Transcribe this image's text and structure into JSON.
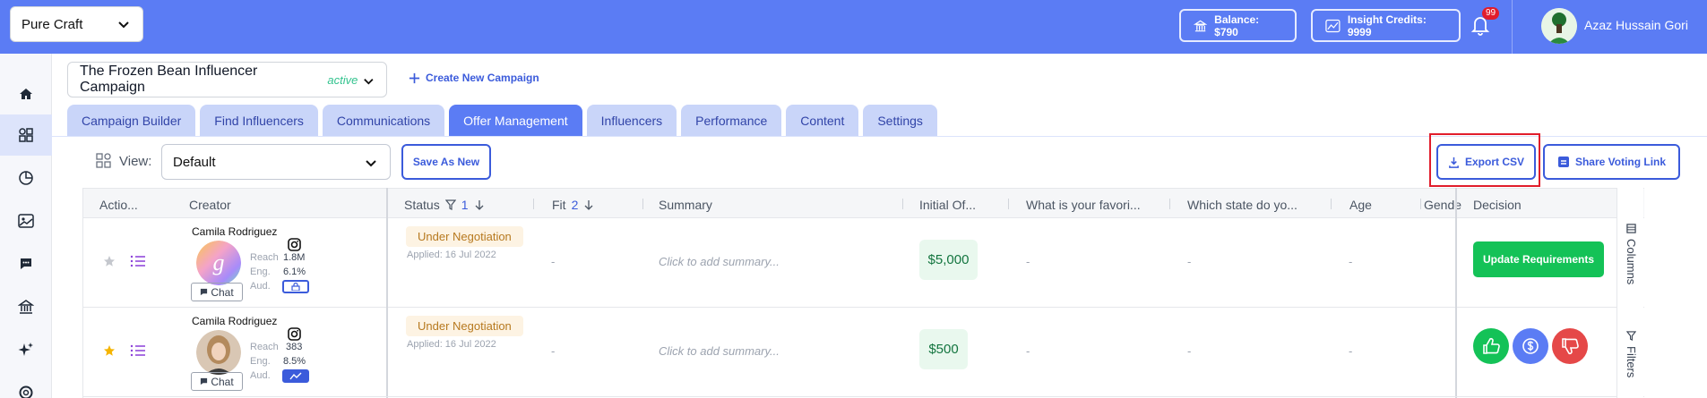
{
  "topbar": {
    "brand": "Pure Craft",
    "balance": "Balance: $790",
    "insight_credits": "Insight Credits: 9999",
    "notification_count": "99",
    "user_name": "Azaz Hussain Gori"
  },
  "campaign": {
    "name": "The Frozen Bean Influencer Campaign",
    "status": "active",
    "create_label": "Create New Campaign"
  },
  "tabs": [
    {
      "label": "Campaign Builder"
    },
    {
      "label": "Find Influencers"
    },
    {
      "label": "Communications"
    },
    {
      "label": "Offer Management"
    },
    {
      "label": "Influencers"
    },
    {
      "label": "Performance"
    },
    {
      "label": "Content"
    },
    {
      "label": "Settings"
    }
  ],
  "active_tab": "Offer Management",
  "viewbar": {
    "view_label": "View:",
    "view_value": "Default",
    "save_as_new": "Save As New",
    "export_csv": "Export CSV",
    "share_voting": "Share Voting Link"
  },
  "table": {
    "columns": {
      "actions": "Actio...",
      "creator": "Creator",
      "status": "Status",
      "status_sort": "1",
      "fit": "Fit",
      "fit_sort": "2",
      "summary": "Summary",
      "initial_offer": "Initial Of...",
      "favorite": "What is your favori...",
      "state": "Which state do yo...",
      "age": "Age",
      "gender": "Gende",
      "decision": "Decision"
    },
    "rows": [
      {
        "creator": "Camila Rodriguez",
        "avatar_letter": "g",
        "chat": "Chat",
        "reach_label": "Reach",
        "reach": "1.8M",
        "eng_label": "Eng.",
        "eng": "6.1%",
        "aud_label": "Aud.",
        "status": "Under Negotiation",
        "applied": "Applied: 16 Jul 2022",
        "fit": "-",
        "summary": "Click to add summary...",
        "offer": "$5,000",
        "favorite": "-",
        "state": "-",
        "age": "-",
        "decision": "Update Requirements"
      },
      {
        "creator": "Camila Rodriguez",
        "chat": "Chat",
        "reach_label": "Reach",
        "reach": "383",
        "eng_label": "Eng.",
        "eng": "8.5%",
        "aud_label": "Aud.",
        "status": "Under Negotiation",
        "applied": "Applied: 16 Jul 2022",
        "fit": "-",
        "summary": "Click to add summary...",
        "offer": "$500",
        "favorite": "-",
        "state": "-",
        "age": "-"
      }
    ]
  },
  "panel": {
    "columns": "Columns",
    "filters": "Filters"
  },
  "colors": {
    "brand_blue": "#5b7cf4",
    "tab_inactive": "#c9d5f9",
    "success_green": "#14c257",
    "decision_blue": "#5b7cf4",
    "decision_red": "#e54848",
    "status_amber": "#b7791f"
  }
}
